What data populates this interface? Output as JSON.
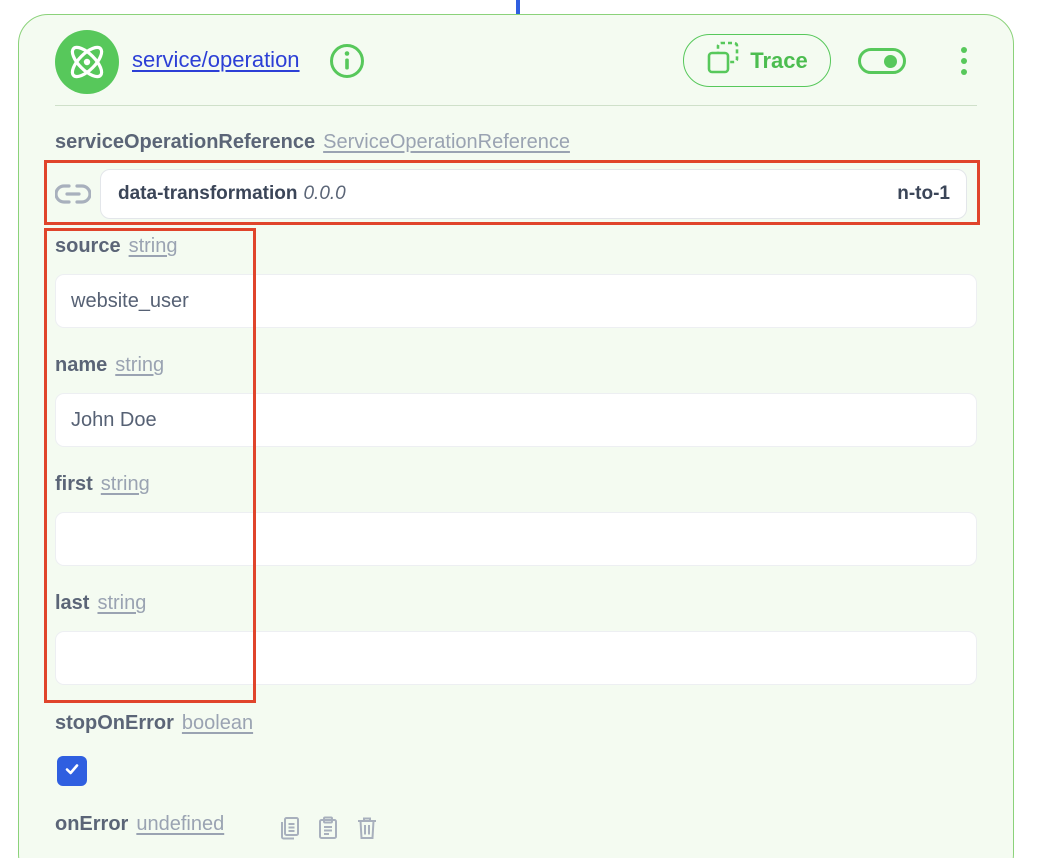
{
  "header": {
    "title": "service/operation",
    "logo_icon": "atom-icon",
    "info_icon": "info-icon",
    "trace_label": "Trace",
    "trace_icon": "copy-dashed-icon",
    "toggle_on": true,
    "more_icon": "more-vertical-icon"
  },
  "reference": {
    "label": "serviceOperationReference",
    "type": "ServiceOperationReference",
    "link_icon": "link-icon",
    "name": "data-transformation",
    "version": "0.0.0",
    "kind": "n-to-1"
  },
  "fields": [
    {
      "label": "source",
      "type": "string",
      "value": "website_user"
    },
    {
      "label": "name",
      "type": "string",
      "value": "John Doe"
    },
    {
      "label": "first",
      "type": "string",
      "value": ""
    },
    {
      "label": "last",
      "type": "string",
      "value": ""
    }
  ],
  "stopOnError": {
    "label": "stopOnError",
    "type": "boolean",
    "checked": true
  },
  "onError": {
    "label": "onError",
    "type": "undefined",
    "actions": [
      "copy-icon",
      "paste-icon",
      "trash-icon"
    ]
  },
  "colors": {
    "accent_green": "#57c85b",
    "card_bg": "#f4fbf1",
    "link_blue": "#2c3fd6",
    "checkbox_blue": "#2f5fe0",
    "highlight_red": "#e0442b"
  }
}
